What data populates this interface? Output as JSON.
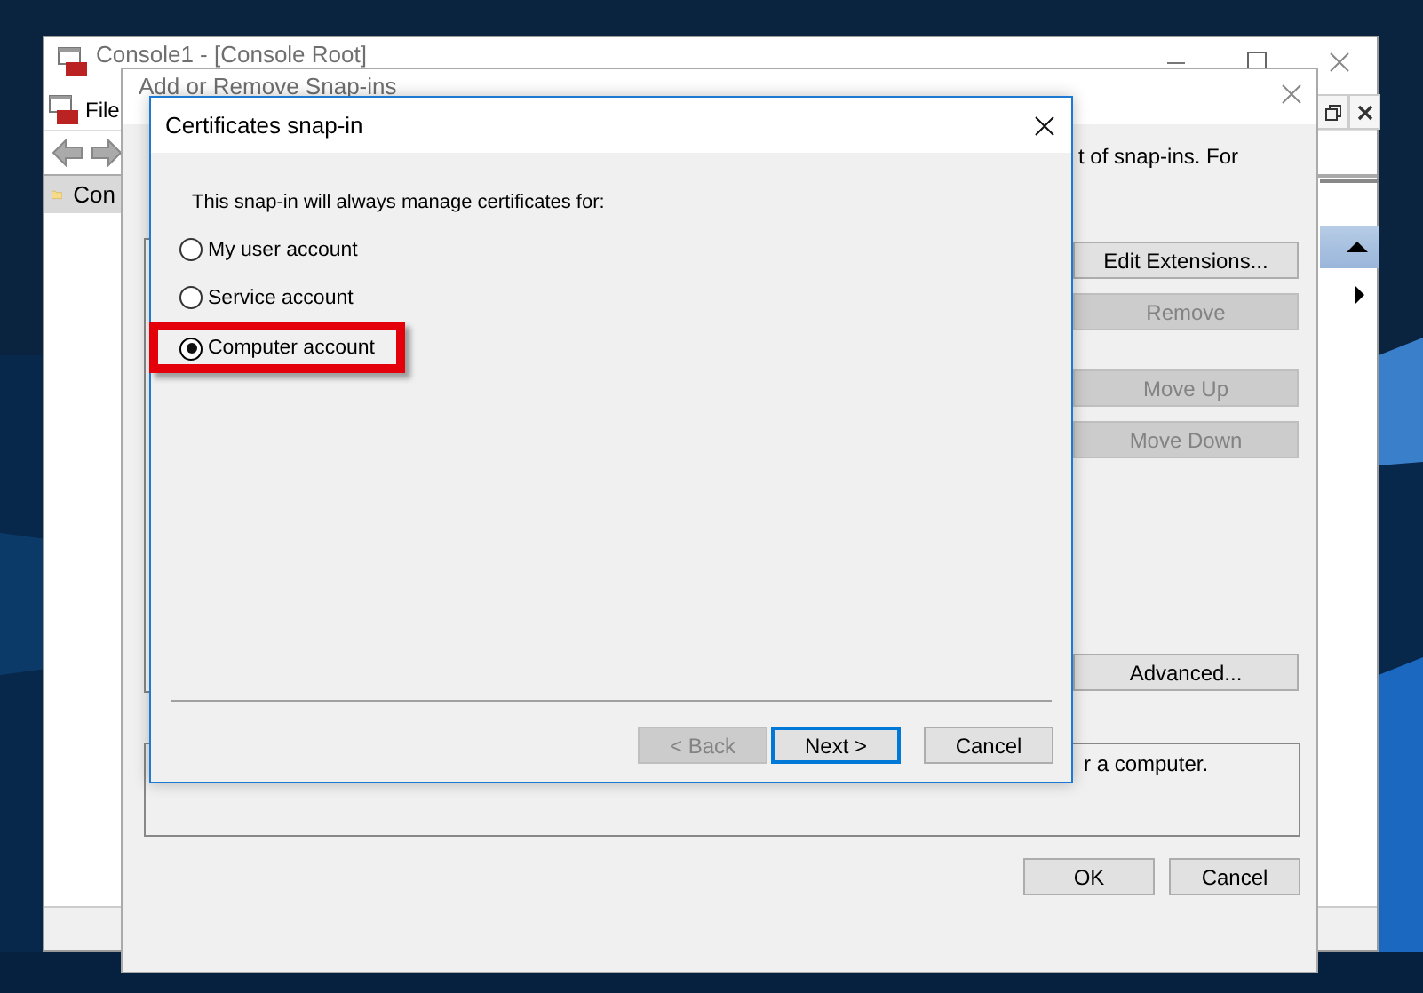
{
  "console_window": {
    "title": "Console1 - [Console Root]",
    "menu": [
      "File"
    ],
    "tree": [
      {
        "label": "Con",
        "selected": true
      }
    ]
  },
  "snapins_dialog": {
    "title": "Add or Remove Snap-ins",
    "intro_fragment": "t of snap-ins. For",
    "description_text": "r a computer.",
    "side_buttons": [
      {
        "label": "Edit Extensions...",
        "disabled": false
      },
      {
        "label": "Remove",
        "disabled": true
      },
      {
        "label": "Move Up",
        "disabled": true
      },
      {
        "label": "Move Down",
        "disabled": true
      },
      {
        "label": "Advanced...",
        "disabled": false
      }
    ],
    "buttons": [
      {
        "label": "OK"
      },
      {
        "label": "Cancel"
      }
    ]
  },
  "certificates_dialog": {
    "title": "Certificates snap-in",
    "prompt": "This snap-in will always manage certificates for:",
    "options": [
      {
        "label": "My user account",
        "selected": false,
        "highlighted": false
      },
      {
        "label": "Service account",
        "selected": false,
        "highlighted": false
      },
      {
        "label": "Computer account",
        "selected": true,
        "highlighted": true
      }
    ],
    "buttons": [
      {
        "label": "< Back",
        "disabled": true,
        "default": false
      },
      {
        "label": "Next >",
        "disabled": false,
        "default": true
      },
      {
        "label": "Cancel",
        "disabled": false,
        "default": false
      }
    ]
  }
}
